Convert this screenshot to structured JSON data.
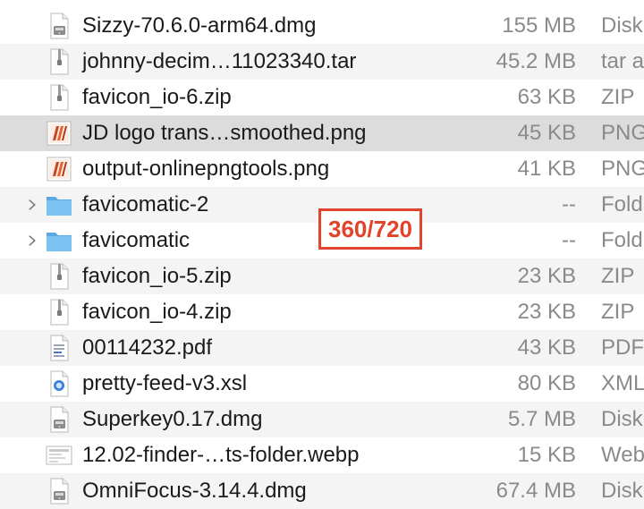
{
  "files": [
    {
      "name": "Sizzy-70.6.0-arm64.dmg",
      "size": "155 MB",
      "kind": "Disk",
      "icon": "dmg-icon"
    },
    {
      "name": "johnny-decim…11023340.tar",
      "size": "45.2 MB",
      "kind": "tar a",
      "icon": "archive-icon"
    },
    {
      "name": "favicon_io-6.zip",
      "size": "63 KB",
      "kind": "ZIP",
      "icon": "zip-icon"
    },
    {
      "name": "JD logo trans…smoothed.png",
      "size": "45 KB",
      "kind": "PNG",
      "icon": "png-logo-icon",
      "selected": true
    },
    {
      "name": "output-onlinepngtools.png",
      "size": "41 KB",
      "kind": "PNG",
      "icon": "png-logo-icon"
    },
    {
      "name": "favicomatic-2",
      "size": "--",
      "kind": "Fold",
      "icon": "folder-icon",
      "folder": true
    },
    {
      "name": "favicomatic",
      "size": "--",
      "kind": "Fold",
      "icon": "folder-icon",
      "folder": true
    },
    {
      "name": "favicon_io-5.zip",
      "size": "23 KB",
      "kind": "ZIP",
      "icon": "zip-icon"
    },
    {
      "name": "favicon_io-4.zip",
      "size": "23 KB",
      "kind": "ZIP",
      "icon": "zip-icon"
    },
    {
      "name": "00114232.pdf",
      "size": "43 KB",
      "kind": "PDF",
      "icon": "pdf-icon"
    },
    {
      "name": "pretty-feed-v3.xsl",
      "size": "80 KB",
      "kind": "XML",
      "icon": "xsl-icon"
    },
    {
      "name": "Superkey0.17.dmg",
      "size": "5.7 MB",
      "kind": "Disk",
      "icon": "dmg-icon"
    },
    {
      "name": "12.02-finder-…ts-folder.webp",
      "size": "15 KB",
      "kind": "Web",
      "icon": "webp-icon"
    },
    {
      "name": "OmniFocus-3.14.4.dmg",
      "size": "67.4 MB",
      "kind": "Disk",
      "icon": "dmg-icon"
    }
  ],
  "overlay_label": "360/720",
  "colors": {
    "selected_row": "#dcdcdc",
    "alt_row": "#f4f4f4",
    "folder": "#6cb8ec",
    "overlay": "#e1442a"
  }
}
